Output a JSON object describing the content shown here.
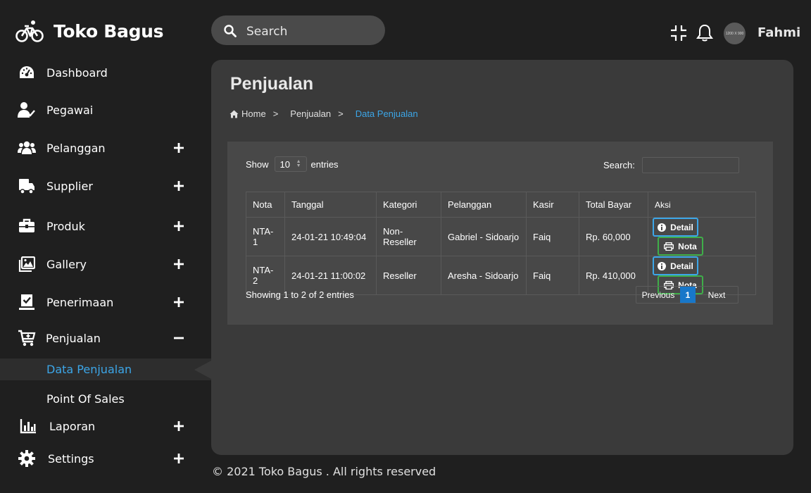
{
  "brand": {
    "name": "Toko Bagus",
    "logo_icon": "bicycle-icon"
  },
  "topbar": {
    "search_placeholder": "Search",
    "username": "Fahmi",
    "avatar_text": "1200 X 900",
    "icons": [
      "search-icon",
      "compress-icon",
      "bell-icon"
    ]
  },
  "sidebar": {
    "items": [
      {
        "label": "Dashboard",
        "icon": "dashboard-icon",
        "toggle": ""
      },
      {
        "label": "Pegawai",
        "icon": "employee-check-icon",
        "toggle": ""
      },
      {
        "label": "Pelanggan",
        "icon": "users-icon",
        "toggle": "+"
      },
      {
        "label": "Supplier",
        "icon": "truck-icon",
        "toggle": "+"
      },
      {
        "label": "Produk",
        "icon": "briefcase-icon",
        "toggle": "+"
      },
      {
        "label": "Gallery",
        "icon": "images-icon",
        "toggle": "+"
      },
      {
        "label": "Penerimaan",
        "icon": "checklist-icon",
        "toggle": "+"
      },
      {
        "label": "Penjualan",
        "icon": "cart-plus-icon",
        "toggle": "−"
      },
      {
        "label": "Laporan",
        "icon": "bar-chart-icon",
        "toggle": "+"
      },
      {
        "label": "Settings",
        "icon": "gear-icon",
        "toggle": "+"
      }
    ],
    "sub_items": [
      {
        "label": "Data Penjualan",
        "active": true
      },
      {
        "label": "Point Of Sales",
        "active": false
      }
    ]
  },
  "main": {
    "title": "Penjualan",
    "breadcrumb": [
      {
        "label": "Home",
        "icon": "home-icon"
      },
      {
        "label": "Penjualan"
      },
      {
        "label": "Data Penjualan",
        "active": true
      }
    ],
    "breadcrumb_sep": ">",
    "show_label": "Show",
    "entries_value": "10",
    "entries_label": "entries",
    "search_label": "Search:",
    "table": {
      "columns": [
        "Nota",
        "Tanggal",
        "Kategori",
        "Pelanggan",
        "Kasir",
        "Total Bayar",
        "Aksi"
      ],
      "rows": [
        {
          "nota": "NTA-1",
          "tanggal": "24-01-21 10:49:04",
          "kategori": "Non-Reseller",
          "pelanggan": "Gabriel - Sidoarjo",
          "kasir": "Faiq",
          "total": "Rp. 60,000"
        },
        {
          "nota": "NTA-2",
          "tanggal": "24-01-21 11:00:02",
          "kategori": "Reseller",
          "pelanggan": "Aresha - Sidoarjo",
          "kasir": "Faiq",
          "total": "Rp. 410,000"
        }
      ],
      "detail_label": "Detail",
      "nota_label": "Nota"
    },
    "info_text": "Showing 1 to 2 of 2 entries",
    "pagination": {
      "previous": "Previous",
      "current": "1",
      "next": "Next"
    }
  },
  "footer": {
    "text": "© 2021 Toko Bagus . All rights reserved"
  },
  "colors": {
    "accent_blue": "#3ca6e8",
    "accent_green": "#3fae49",
    "page_bg": "#1f1f1f",
    "card_bg": "#3a3a3a",
    "panel_bg": "#484848",
    "pager_active": "#1877c9"
  }
}
